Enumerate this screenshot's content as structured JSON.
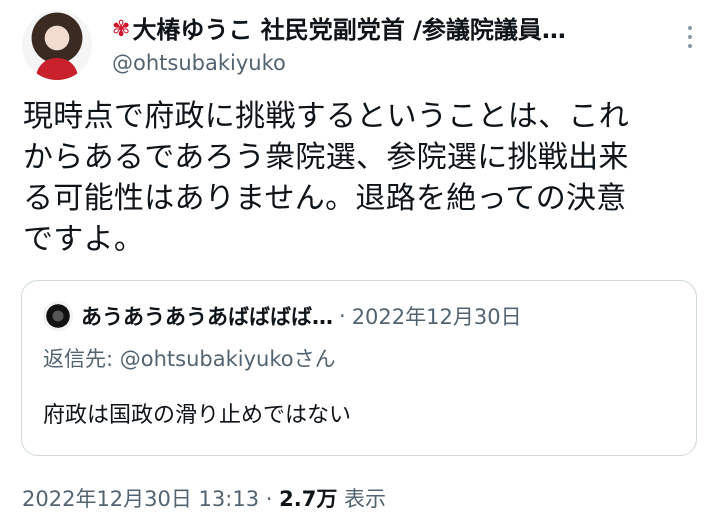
{
  "author": {
    "name": "大椿ゆうこ 社民党副党首 /参議院議員…",
    "handle": "@ohtsubakiyuko",
    "flower_emoji": "✾"
  },
  "tweet": {
    "text": "現時点で府政に挑戦するということは、これ\nからあるであろう衆院選、参院選に挑戦出来\nる可能性はありません。退路を絶っての決意\nですよ。"
  },
  "quote": {
    "author_name": "あうあうあうあばばばば…",
    "separator": "·",
    "date": "2022年12月30日",
    "reply_label": "返信先: ",
    "reply_handle": "@ohtsubakiyuko",
    "reply_suffix": "さん",
    "text": "府政は国政の滑り止めではない"
  },
  "footer": {
    "timestamp": "2022年12月30日 13:13",
    "separator": "·",
    "views": "2.7万",
    "views_label": "表示"
  }
}
